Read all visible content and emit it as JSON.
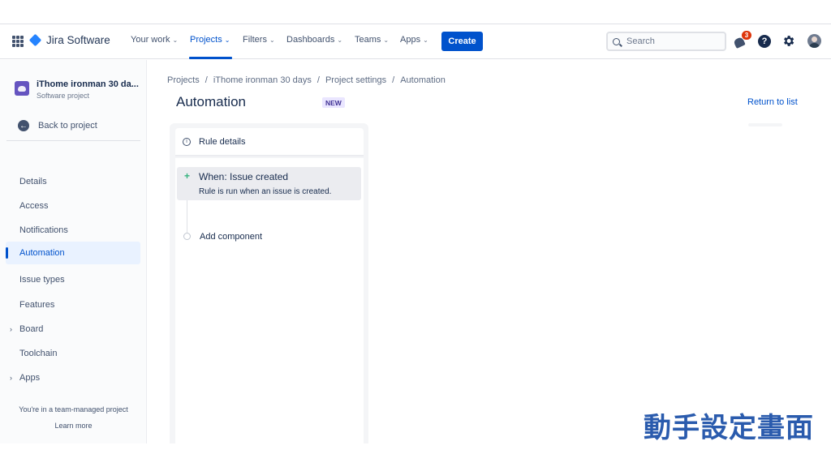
{
  "nav": {
    "product_name": "Jira Software",
    "items": [
      {
        "label": "Your work",
        "has_dropdown": true,
        "active": false
      },
      {
        "label": "Projects",
        "has_dropdown": true,
        "active": true
      },
      {
        "label": "Filters",
        "has_dropdown": true,
        "active": false
      },
      {
        "label": "Dashboards",
        "has_dropdown": true,
        "active": false
      },
      {
        "label": "Teams",
        "has_dropdown": true,
        "active": false
      },
      {
        "label": "Apps",
        "has_dropdown": true,
        "active": false
      }
    ],
    "create_label": "Create",
    "search_placeholder": "Search",
    "notification_count": "3",
    "help_glyph": "?"
  },
  "sidebar": {
    "project_name": "iThome ironman 30 da...",
    "project_type": "Software project",
    "back_label": "Back to project",
    "items": [
      {
        "label": "Details"
      },
      {
        "label": "Access"
      },
      {
        "label": "Notifications"
      },
      {
        "label": "Automation"
      },
      {
        "label": "Issue types"
      },
      {
        "label": "Features"
      },
      {
        "label": "Board"
      },
      {
        "label": "Toolchain"
      },
      {
        "label": "Apps"
      }
    ],
    "team_note": "You're in a team-managed project",
    "learn_more": "Learn more"
  },
  "main": {
    "breadcrumbs": [
      "Projects",
      "iThome ironman 30 days",
      "Project settings",
      "Automation"
    ],
    "breadcrumb_separator": "/",
    "title": "Automation",
    "new_badge": "NEW",
    "return_link": "Return to list",
    "rule": {
      "details_label": "Rule details",
      "trigger_title": "When: Issue created",
      "trigger_desc": "Rule is run when an issue is created.",
      "add_component": "Add component"
    }
  },
  "overlay_caption": "動手設定畫面",
  "colors": {
    "brand_blue": "#0052cc",
    "jira_diamond": "#2684ff",
    "notification_red": "#de350b",
    "new_badge_bg": "#eae6ff",
    "trigger_plus": "#36b37e",
    "overlay_text": "#2a5bad"
  },
  "icons": [
    "app-switcher-icon",
    "jira-logo-icon",
    "search-icon",
    "notification-bell-icon",
    "help-icon",
    "settings-gear-icon",
    "profile-avatar",
    "back-arrow-icon",
    "info-icon",
    "plus-icon",
    "chevron-right-icon"
  ]
}
